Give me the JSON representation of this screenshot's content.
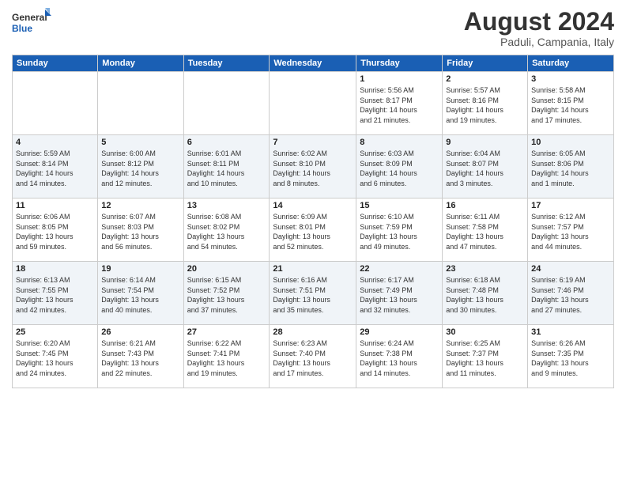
{
  "logo": {
    "line1": "General",
    "line2": "Blue"
  },
  "header": {
    "month_year": "August 2024",
    "location": "Paduli, Campania, Italy"
  },
  "weekdays": [
    "Sunday",
    "Monday",
    "Tuesday",
    "Wednesday",
    "Thursday",
    "Friday",
    "Saturday"
  ],
  "weeks": [
    [
      {
        "day": "",
        "info": ""
      },
      {
        "day": "",
        "info": ""
      },
      {
        "day": "",
        "info": ""
      },
      {
        "day": "",
        "info": ""
      },
      {
        "day": "1",
        "info": "Sunrise: 5:56 AM\nSunset: 8:17 PM\nDaylight: 14 hours\nand 21 minutes."
      },
      {
        "day": "2",
        "info": "Sunrise: 5:57 AM\nSunset: 8:16 PM\nDaylight: 14 hours\nand 19 minutes."
      },
      {
        "day": "3",
        "info": "Sunrise: 5:58 AM\nSunset: 8:15 PM\nDaylight: 14 hours\nand 17 minutes."
      }
    ],
    [
      {
        "day": "4",
        "info": "Sunrise: 5:59 AM\nSunset: 8:14 PM\nDaylight: 14 hours\nand 14 minutes."
      },
      {
        "day": "5",
        "info": "Sunrise: 6:00 AM\nSunset: 8:12 PM\nDaylight: 14 hours\nand 12 minutes."
      },
      {
        "day": "6",
        "info": "Sunrise: 6:01 AM\nSunset: 8:11 PM\nDaylight: 14 hours\nand 10 minutes."
      },
      {
        "day": "7",
        "info": "Sunrise: 6:02 AM\nSunset: 8:10 PM\nDaylight: 14 hours\nand 8 minutes."
      },
      {
        "day": "8",
        "info": "Sunrise: 6:03 AM\nSunset: 8:09 PM\nDaylight: 14 hours\nand 6 minutes."
      },
      {
        "day": "9",
        "info": "Sunrise: 6:04 AM\nSunset: 8:07 PM\nDaylight: 14 hours\nand 3 minutes."
      },
      {
        "day": "10",
        "info": "Sunrise: 6:05 AM\nSunset: 8:06 PM\nDaylight: 14 hours\nand 1 minute."
      }
    ],
    [
      {
        "day": "11",
        "info": "Sunrise: 6:06 AM\nSunset: 8:05 PM\nDaylight: 13 hours\nand 59 minutes."
      },
      {
        "day": "12",
        "info": "Sunrise: 6:07 AM\nSunset: 8:03 PM\nDaylight: 13 hours\nand 56 minutes."
      },
      {
        "day": "13",
        "info": "Sunrise: 6:08 AM\nSunset: 8:02 PM\nDaylight: 13 hours\nand 54 minutes."
      },
      {
        "day": "14",
        "info": "Sunrise: 6:09 AM\nSunset: 8:01 PM\nDaylight: 13 hours\nand 52 minutes."
      },
      {
        "day": "15",
        "info": "Sunrise: 6:10 AM\nSunset: 7:59 PM\nDaylight: 13 hours\nand 49 minutes."
      },
      {
        "day": "16",
        "info": "Sunrise: 6:11 AM\nSunset: 7:58 PM\nDaylight: 13 hours\nand 47 minutes."
      },
      {
        "day": "17",
        "info": "Sunrise: 6:12 AM\nSunset: 7:57 PM\nDaylight: 13 hours\nand 44 minutes."
      }
    ],
    [
      {
        "day": "18",
        "info": "Sunrise: 6:13 AM\nSunset: 7:55 PM\nDaylight: 13 hours\nand 42 minutes."
      },
      {
        "day": "19",
        "info": "Sunrise: 6:14 AM\nSunset: 7:54 PM\nDaylight: 13 hours\nand 40 minutes."
      },
      {
        "day": "20",
        "info": "Sunrise: 6:15 AM\nSunset: 7:52 PM\nDaylight: 13 hours\nand 37 minutes."
      },
      {
        "day": "21",
        "info": "Sunrise: 6:16 AM\nSunset: 7:51 PM\nDaylight: 13 hours\nand 35 minutes."
      },
      {
        "day": "22",
        "info": "Sunrise: 6:17 AM\nSunset: 7:49 PM\nDaylight: 13 hours\nand 32 minutes."
      },
      {
        "day": "23",
        "info": "Sunrise: 6:18 AM\nSunset: 7:48 PM\nDaylight: 13 hours\nand 30 minutes."
      },
      {
        "day": "24",
        "info": "Sunrise: 6:19 AM\nSunset: 7:46 PM\nDaylight: 13 hours\nand 27 minutes."
      }
    ],
    [
      {
        "day": "25",
        "info": "Sunrise: 6:20 AM\nSunset: 7:45 PM\nDaylight: 13 hours\nand 24 minutes."
      },
      {
        "day": "26",
        "info": "Sunrise: 6:21 AM\nSunset: 7:43 PM\nDaylight: 13 hours\nand 22 minutes."
      },
      {
        "day": "27",
        "info": "Sunrise: 6:22 AM\nSunset: 7:41 PM\nDaylight: 13 hours\nand 19 minutes."
      },
      {
        "day": "28",
        "info": "Sunrise: 6:23 AM\nSunset: 7:40 PM\nDaylight: 13 hours\nand 17 minutes."
      },
      {
        "day": "29",
        "info": "Sunrise: 6:24 AM\nSunset: 7:38 PM\nDaylight: 13 hours\nand 14 minutes."
      },
      {
        "day": "30",
        "info": "Sunrise: 6:25 AM\nSunset: 7:37 PM\nDaylight: 13 hours\nand 11 minutes."
      },
      {
        "day": "31",
        "info": "Sunrise: 6:26 AM\nSunset: 7:35 PM\nDaylight: 13 hours\nand 9 minutes."
      }
    ]
  ]
}
